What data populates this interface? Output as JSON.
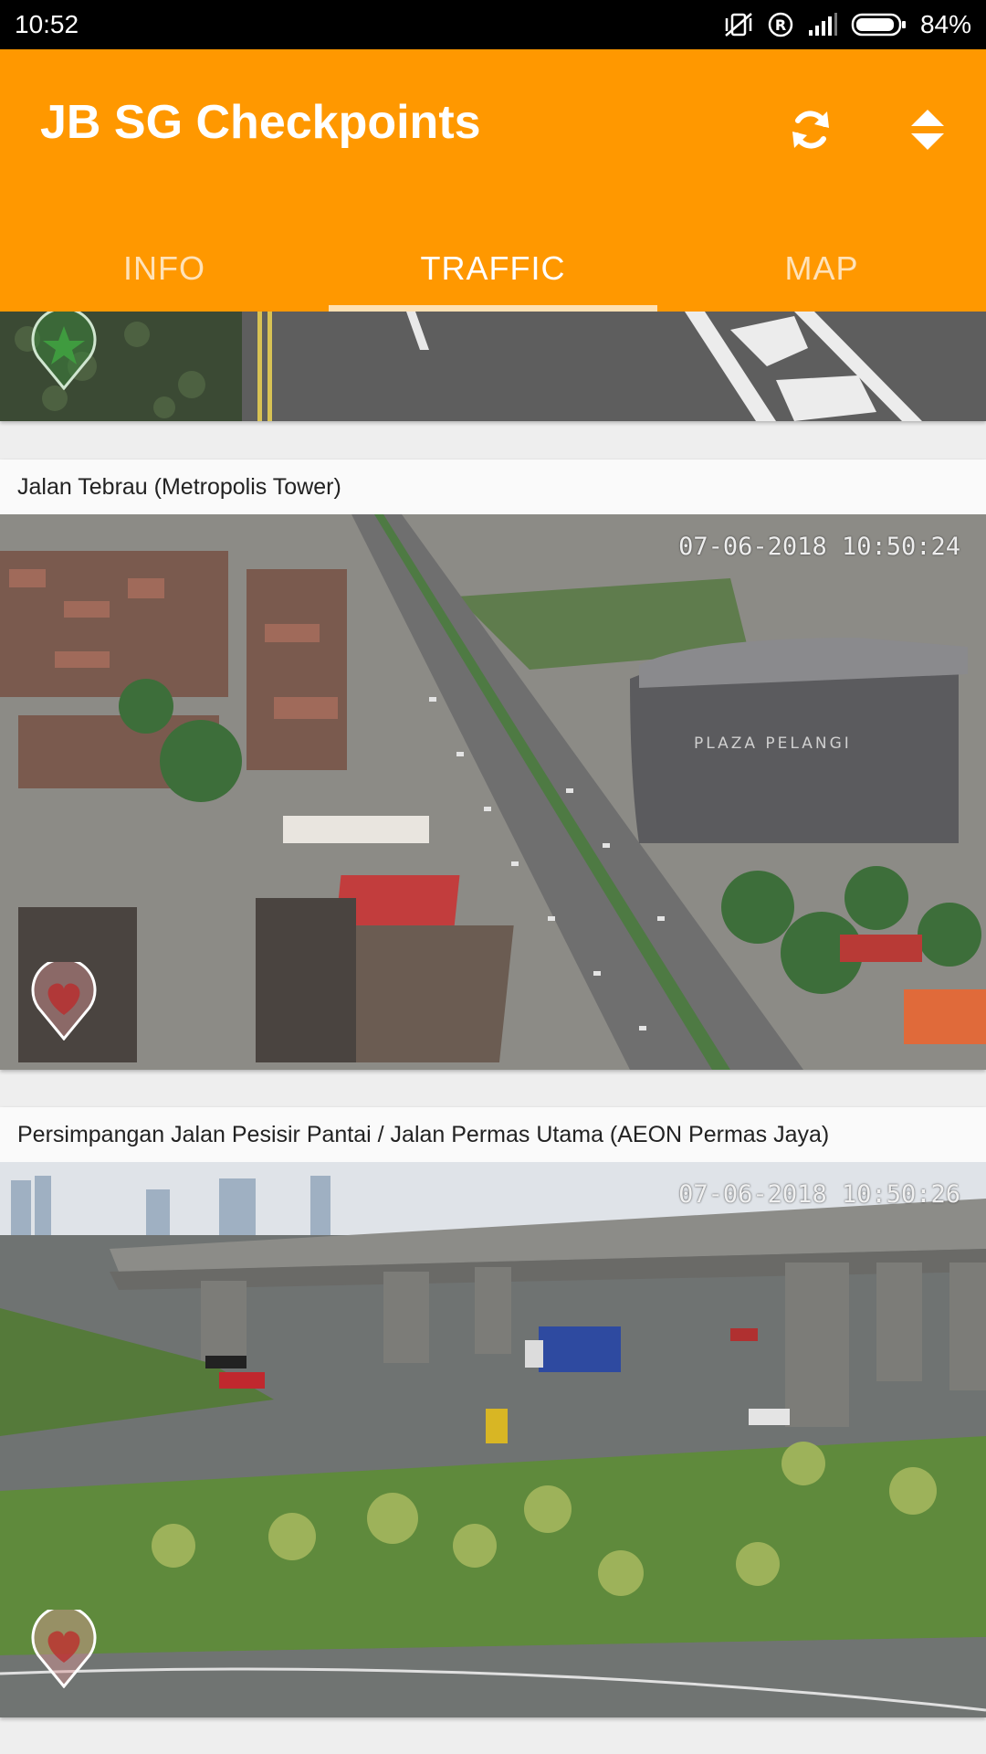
{
  "status_bar": {
    "time": "10:52",
    "battery": "84%",
    "icons": [
      "vibrate-off-icon",
      "registered-icon",
      "signal-icon",
      "battery-icon"
    ]
  },
  "app": {
    "title": "JB SG Checkpoints",
    "actions": [
      "refresh-icon",
      "sort-icon"
    ],
    "tabs": [
      {
        "label": "INFO",
        "active": false
      },
      {
        "label": "TRAFFIC",
        "active": true
      },
      {
        "label": "MAP",
        "active": false
      }
    ]
  },
  "cameras": [
    {
      "title": "",
      "timestamp": "",
      "favorite_icon": "star-pin-icon"
    },
    {
      "title": "Jalan Tebrau (Metropolis Tower)",
      "timestamp": "07-06-2018 10:50:24",
      "favorite_icon": "heart-pin-icon"
    },
    {
      "title": "Persimpangan Jalan Pesisir Pantai / Jalan Permas Utama (AEON Permas Jaya)",
      "timestamp": "07-06-2018 10:50:26",
      "favorite_icon": "heart-pin-icon"
    }
  ],
  "colors": {
    "primary": "#ff9800",
    "tab_indicator": "#ffe0b2",
    "status_bar": "#000000"
  }
}
